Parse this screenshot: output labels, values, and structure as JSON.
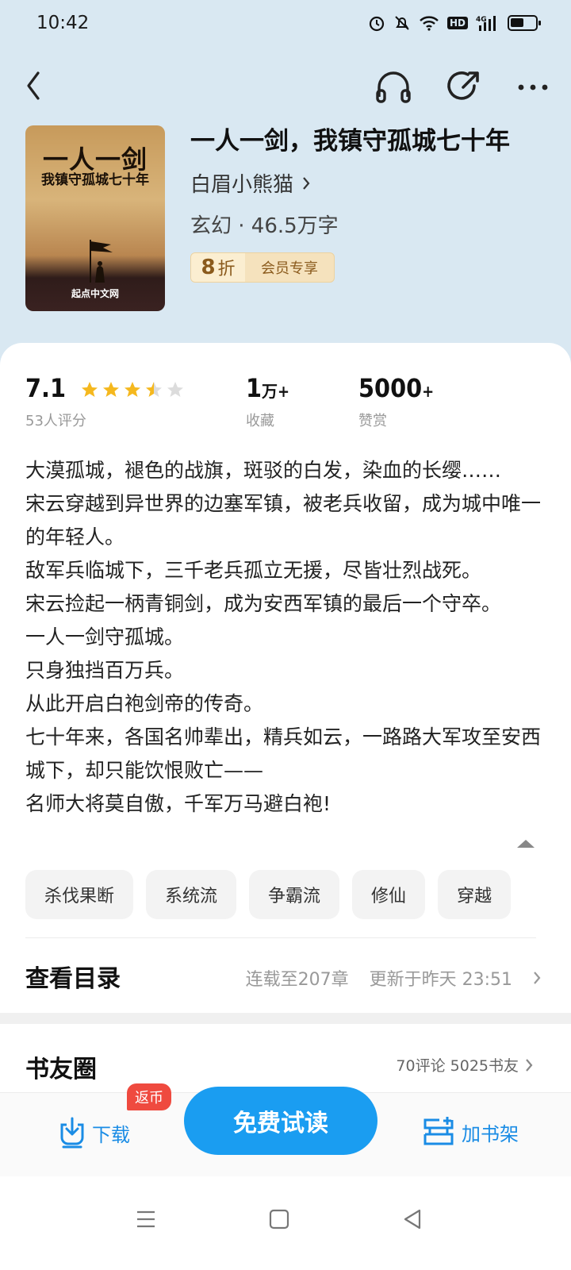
{
  "status_bar": {
    "time": "10:42",
    "hd": "HD",
    "network": "4G"
  },
  "book": {
    "title": "一人一剑，我镇守孤城七十年",
    "author": "白眉小熊猫",
    "meta": "玄幻 · 46.5万字",
    "discount_value": "8",
    "discount_unit": "折",
    "discount_label": "会员专享",
    "cover_title_1": "一人一剑",
    "cover_title_2": "我镇守孤城七十年",
    "cover_publisher": "起点中文网"
  },
  "stats": {
    "rating": "7.1",
    "rating_stars": 3.5,
    "rating_count": "53人评分",
    "favorites": "1",
    "favorites_unit": "万+",
    "favorites_label": "收藏",
    "rewards": "5000",
    "rewards_unit": "+",
    "rewards_label": "赞赏"
  },
  "description": [
    "大漠孤城，褪色的战旗，斑驳的白发，染血的长缨……",
    "宋云穿越到异世界的边塞军镇，被老兵收留，成为城中唯一的年轻人。",
    "敌军兵临城下，三千老兵孤立无援，尽皆壮烈战死。",
    "宋云捡起一柄青铜剑，成为安西军镇的最后一个守卒。",
    "一人一剑守孤城。",
    "只身独挡百万兵。",
    "从此开启白袍剑帝的传奇。",
    "七十年来，各国名帅辈出，精兵如云，一路路大军攻至安西城下，却只能饮恨败亡——",
    "名师大将莫自傲，千军万马避白袍!"
  ],
  "tags": [
    "杀伐果断",
    "系统流",
    "争霸流",
    "修仙",
    "穿越"
  ],
  "catalog": {
    "title": "查看目录",
    "progress": "连载至207章",
    "updated": "更新于昨天 23:51"
  },
  "friends": {
    "title": "书友圈",
    "summary": "70评论 5025书友"
  },
  "bottom": {
    "download": "下载",
    "badge": "返币",
    "read": "免费试读",
    "add_shelf": "加书架"
  },
  "colors": {
    "accent": "#1a9df1",
    "header_bg": "#d9e8f2",
    "star": "#f5b81e",
    "badge": "#ef4a3f"
  }
}
